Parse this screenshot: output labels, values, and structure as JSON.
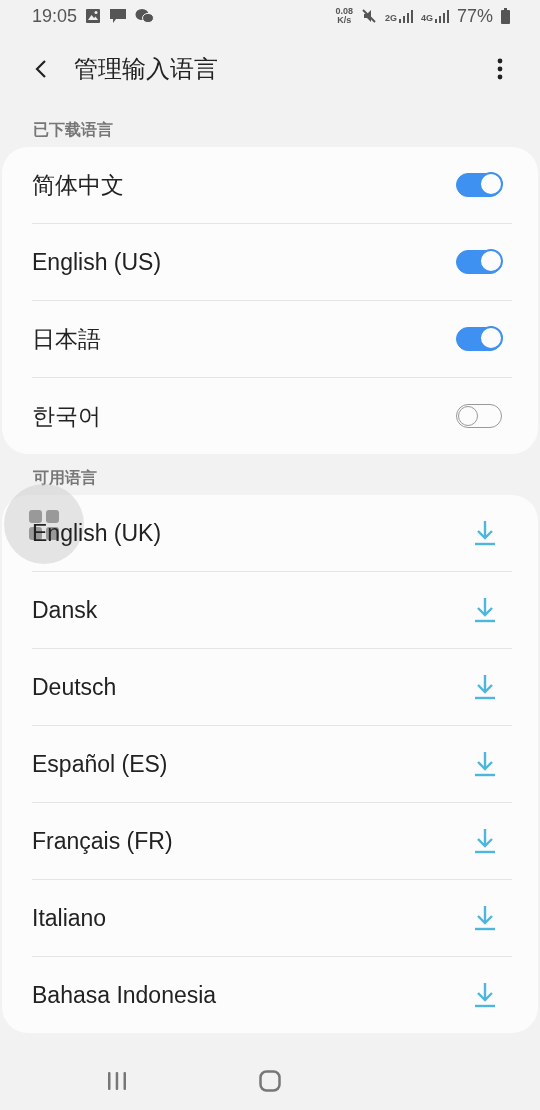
{
  "status_bar": {
    "time": "19:05",
    "speed_value": "0.08",
    "speed_unit": "K/s",
    "sim1": "2G",
    "sim2": "4G",
    "battery": "77%"
  },
  "header": {
    "title": "管理输入语言"
  },
  "sections": [
    {
      "title": "已下载语言",
      "items": [
        {
          "kind": "toggle",
          "label": "简体中文",
          "on": true
        },
        {
          "kind": "toggle",
          "label": "English (US)",
          "on": true
        },
        {
          "kind": "toggle",
          "label": "日本語",
          "on": true
        },
        {
          "kind": "toggle",
          "label": "한국어",
          "on": false
        }
      ]
    },
    {
      "title": "可用语言",
      "items": [
        {
          "kind": "download",
          "label": "English (UK)"
        },
        {
          "kind": "download",
          "label": "Dansk"
        },
        {
          "kind": "download",
          "label": "Deutsch"
        },
        {
          "kind": "download",
          "label": "Español (ES)"
        },
        {
          "kind": "download",
          "label": "Français (FR)"
        },
        {
          "kind": "download",
          "label": "Italiano"
        },
        {
          "kind": "download",
          "label": "Bahasa Indonesia"
        }
      ]
    }
  ]
}
